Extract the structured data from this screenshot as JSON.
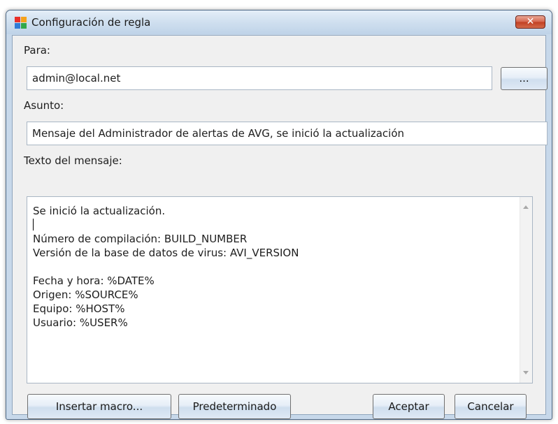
{
  "window": {
    "title": "Configuración de regla",
    "close_label": "✕"
  },
  "form": {
    "to_label": "Para:",
    "to_value": "admin@local.net",
    "browse_label": "...",
    "subject_label": "Asunto:",
    "subject_value": "Mensaje del Administrador de alertas de AVG, se inició la actualización",
    "message_label": "Texto del mensaje:",
    "message_lines": [
      "Se inició la actualización.",
      "",
      "Número de compilación: BUILD_NUMBER",
      "Versión de la base de datos de virus: AVI_VERSION",
      "",
      "Fecha y hora: %DATE%",
      "Origen: %SOURCE%",
      "Equipo: %HOST%",
      "Usuario: %USER%"
    ]
  },
  "buttons": {
    "insert_macro": "Insertar macro...",
    "default": "Predeterminado",
    "accept": "Aceptar",
    "cancel": "Cancelar"
  },
  "colors": {
    "window_frame": "#c7d8ea",
    "client_bg": "#f0f0f0",
    "close_button": "#c8452a"
  }
}
